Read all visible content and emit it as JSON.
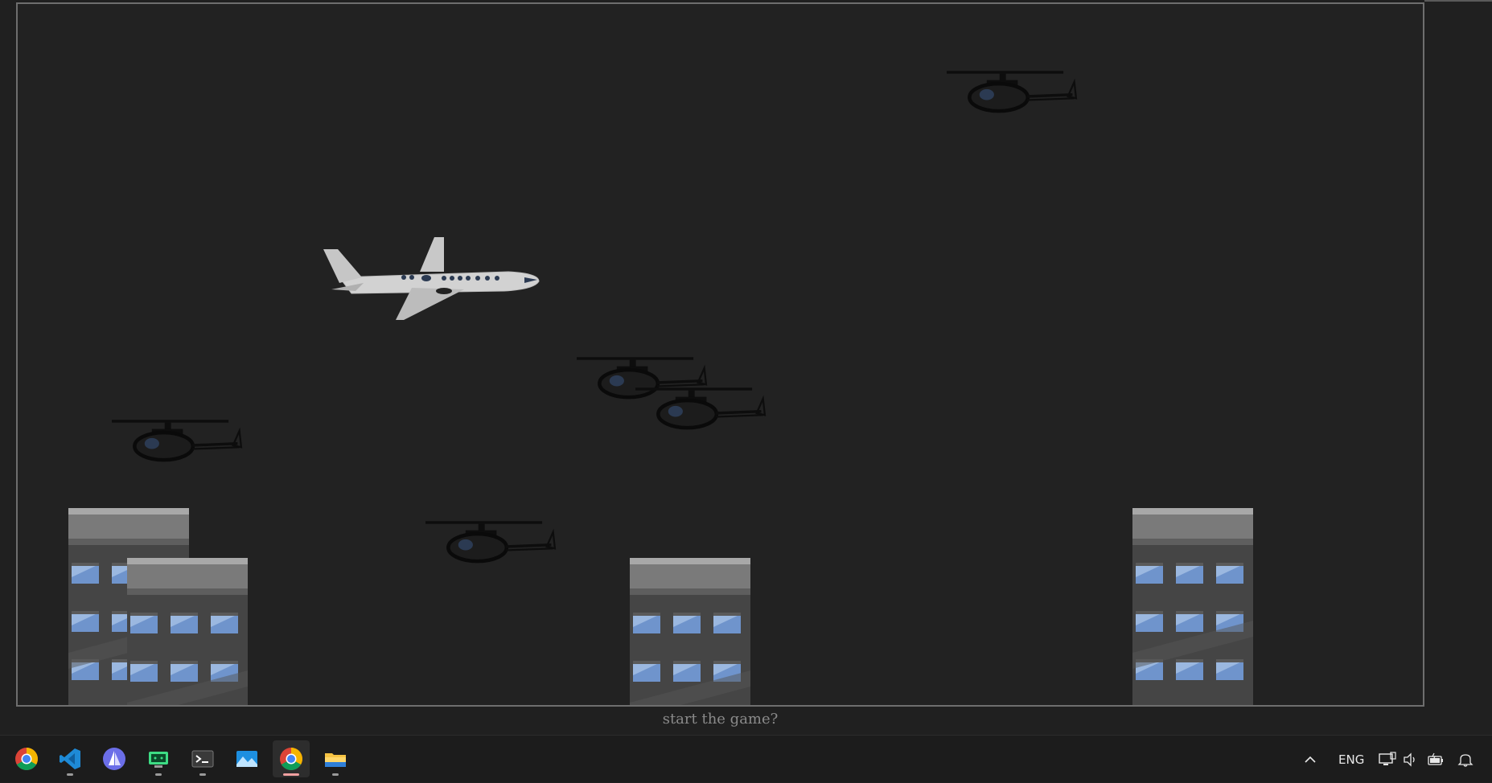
{
  "game": {
    "prompt": "start the game?",
    "colors": {
      "sky": "#222222",
      "border": "#6e6e6e",
      "plane": "#cfcfcf",
      "helicopter": "#111111",
      "building": "#4a4a4a",
      "window": "#6a8fc8"
    }
  },
  "taskbar": {
    "apps": [
      {
        "name": "chrome-icon"
      },
      {
        "name": "vscode-icon"
      },
      {
        "name": "sail-app-icon"
      },
      {
        "name": "android-studio-icon"
      },
      {
        "name": "terminal-icon"
      },
      {
        "name": "photos-icon"
      },
      {
        "name": "chrome-icon"
      },
      {
        "name": "file-explorer-icon"
      }
    ],
    "tray": {
      "language": "ENG"
    }
  }
}
